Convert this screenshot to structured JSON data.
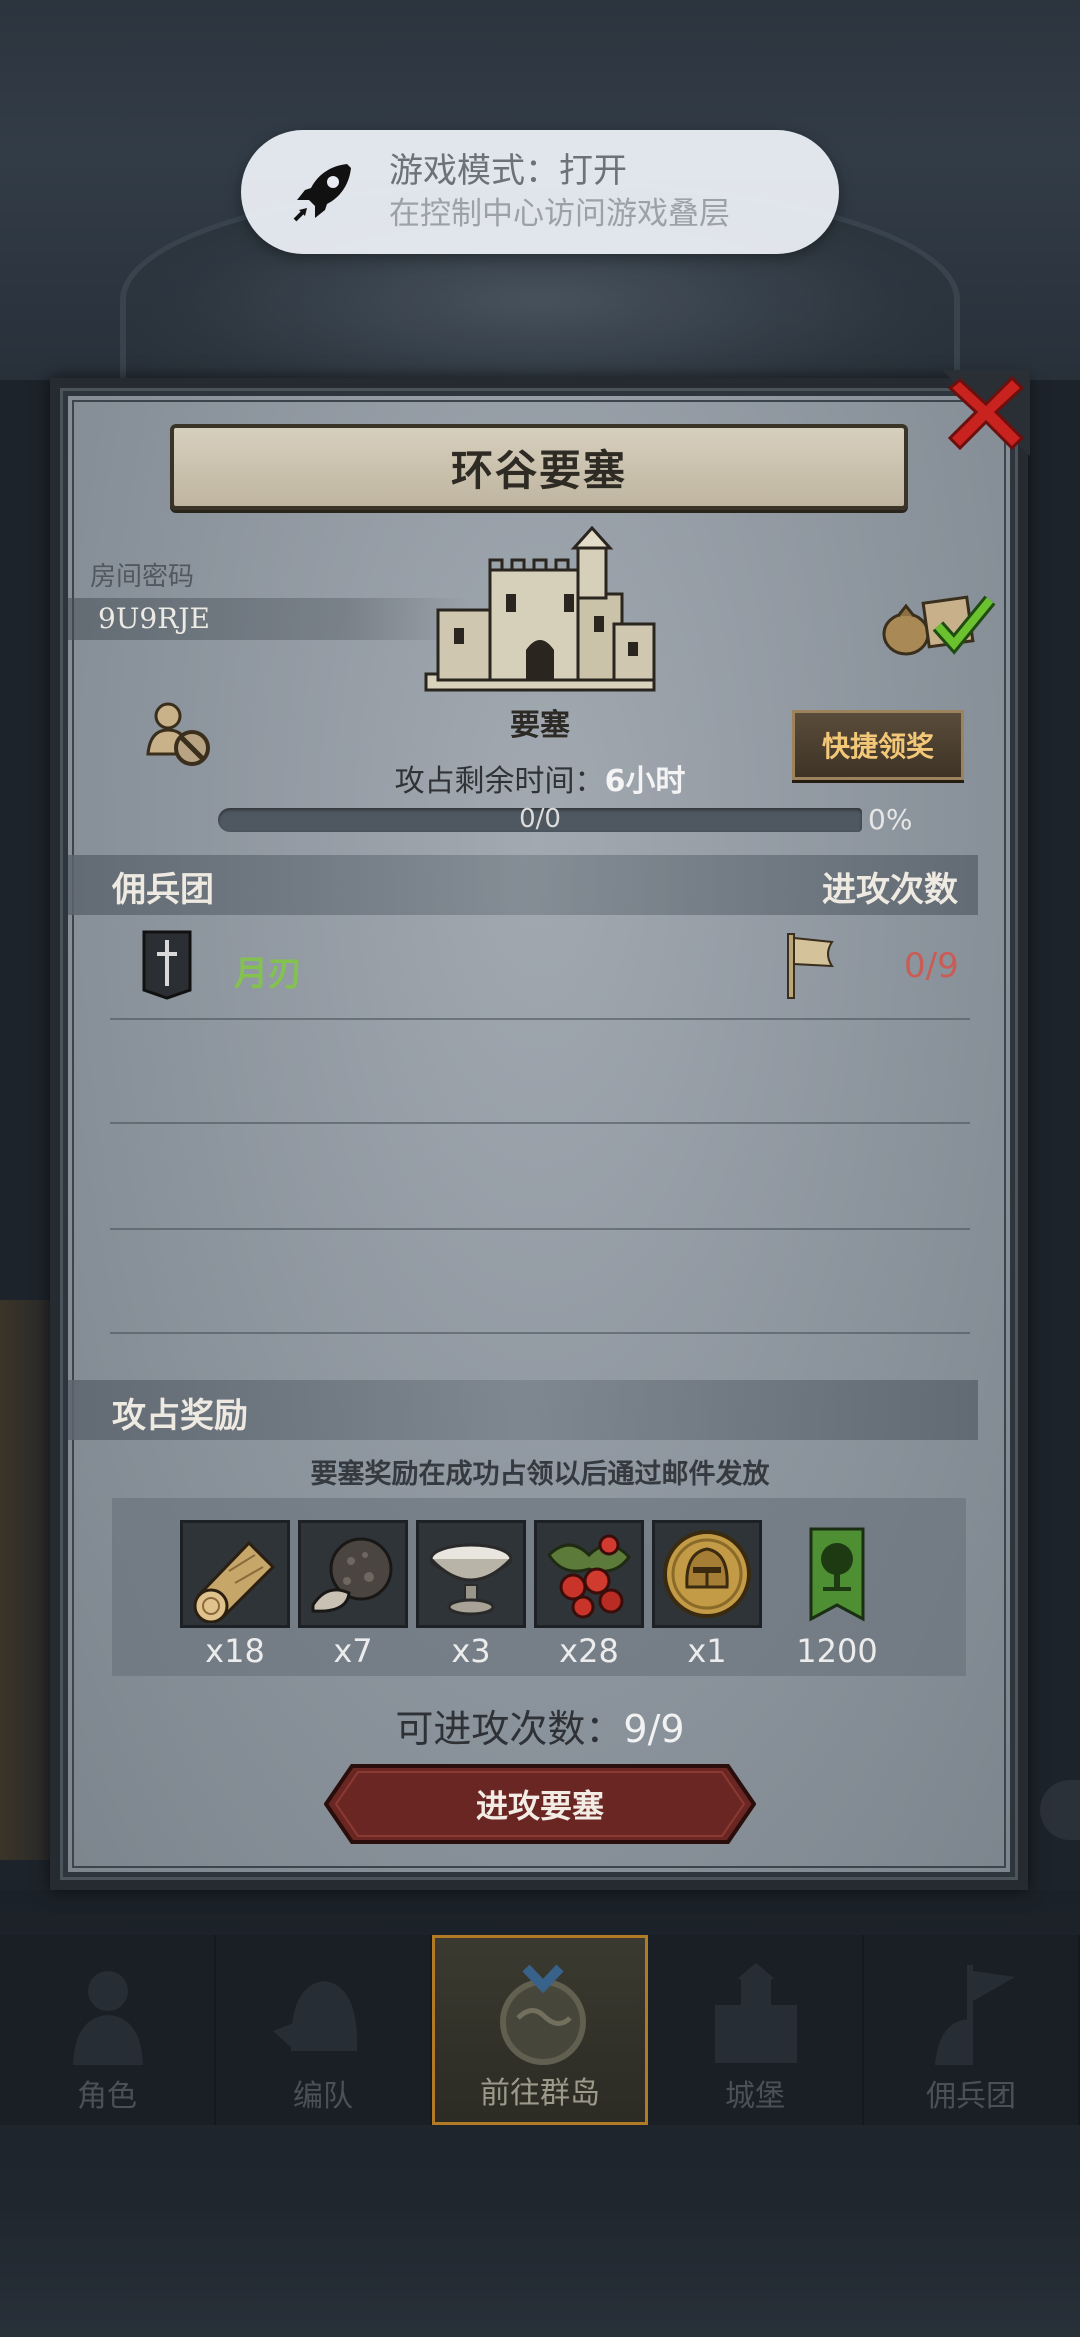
{
  "toast": {
    "title": "游戏模式：打开",
    "subtitle": "在控制中心访问游戏叠层"
  },
  "fortress": {
    "title": "环谷要塞",
    "room_label": "房间密码",
    "room_code": "9U9RJE",
    "building_name": "要塞",
    "quick_claim_label": "快捷领奖",
    "time_prefix": "攻占剩余时间：",
    "time_value": "6小时",
    "progress_text": "0/0",
    "progress_percent": "0%",
    "progress_fraction": 0
  },
  "mercenary_section": {
    "title": "佣兵团",
    "attack_header": "进攻次数",
    "rows": [
      {
        "name": "月刃",
        "attacks": "0/9"
      }
    ]
  },
  "rewards_section": {
    "title": "攻占奖励",
    "note": "要塞奖励在成功占领以后通过邮件发放",
    "items": [
      {
        "icon": "wood-log-icon",
        "qty": "x18"
      },
      {
        "icon": "truffle-icon",
        "qty": "x7"
      },
      {
        "icon": "silver-bowl-icon",
        "qty": "x3"
      },
      {
        "icon": "berries-icon",
        "qty": "x28"
      },
      {
        "icon": "helmet-coin-icon",
        "qty": "x1"
      },
      {
        "icon": "tree-banner-icon",
        "qty": "1200"
      }
    ]
  },
  "attacks_left": {
    "label": "可进攻次数：",
    "value": "9/9"
  },
  "attack_button_label": "进攻要塞",
  "nav": {
    "items": [
      {
        "label": "角色"
      },
      {
        "label": "编队"
      },
      {
        "label": "前往群岛"
      },
      {
        "label": "城堡"
      },
      {
        "label": "佣兵团"
      }
    ],
    "active_index": 2
  },
  "colors": {
    "merc_name": "#84c250",
    "attack_count": "#c95c55",
    "quick_claim_text": "#f2c878",
    "active_nav_border": "#b07b24",
    "close_red": "#c8231f"
  }
}
